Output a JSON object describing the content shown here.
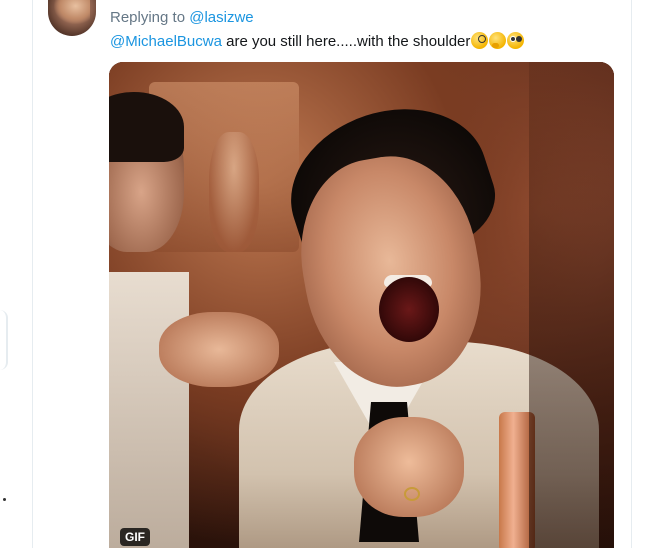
{
  "reply": {
    "prefix": "Replying to",
    "handle": "@lasizwe"
  },
  "tweet": {
    "mention": "@MichaelBucwa",
    "text": "  are you still here.....with the shoulder",
    "emojis": [
      "face-with-monocle",
      "thinking-face",
      "flushed-face"
    ]
  },
  "media": {
    "badge": "GIF"
  },
  "colors": {
    "link": "#1b95e0",
    "secondary_text": "#657786",
    "primary_text": "#14171a",
    "border": "#e6ecf0"
  }
}
